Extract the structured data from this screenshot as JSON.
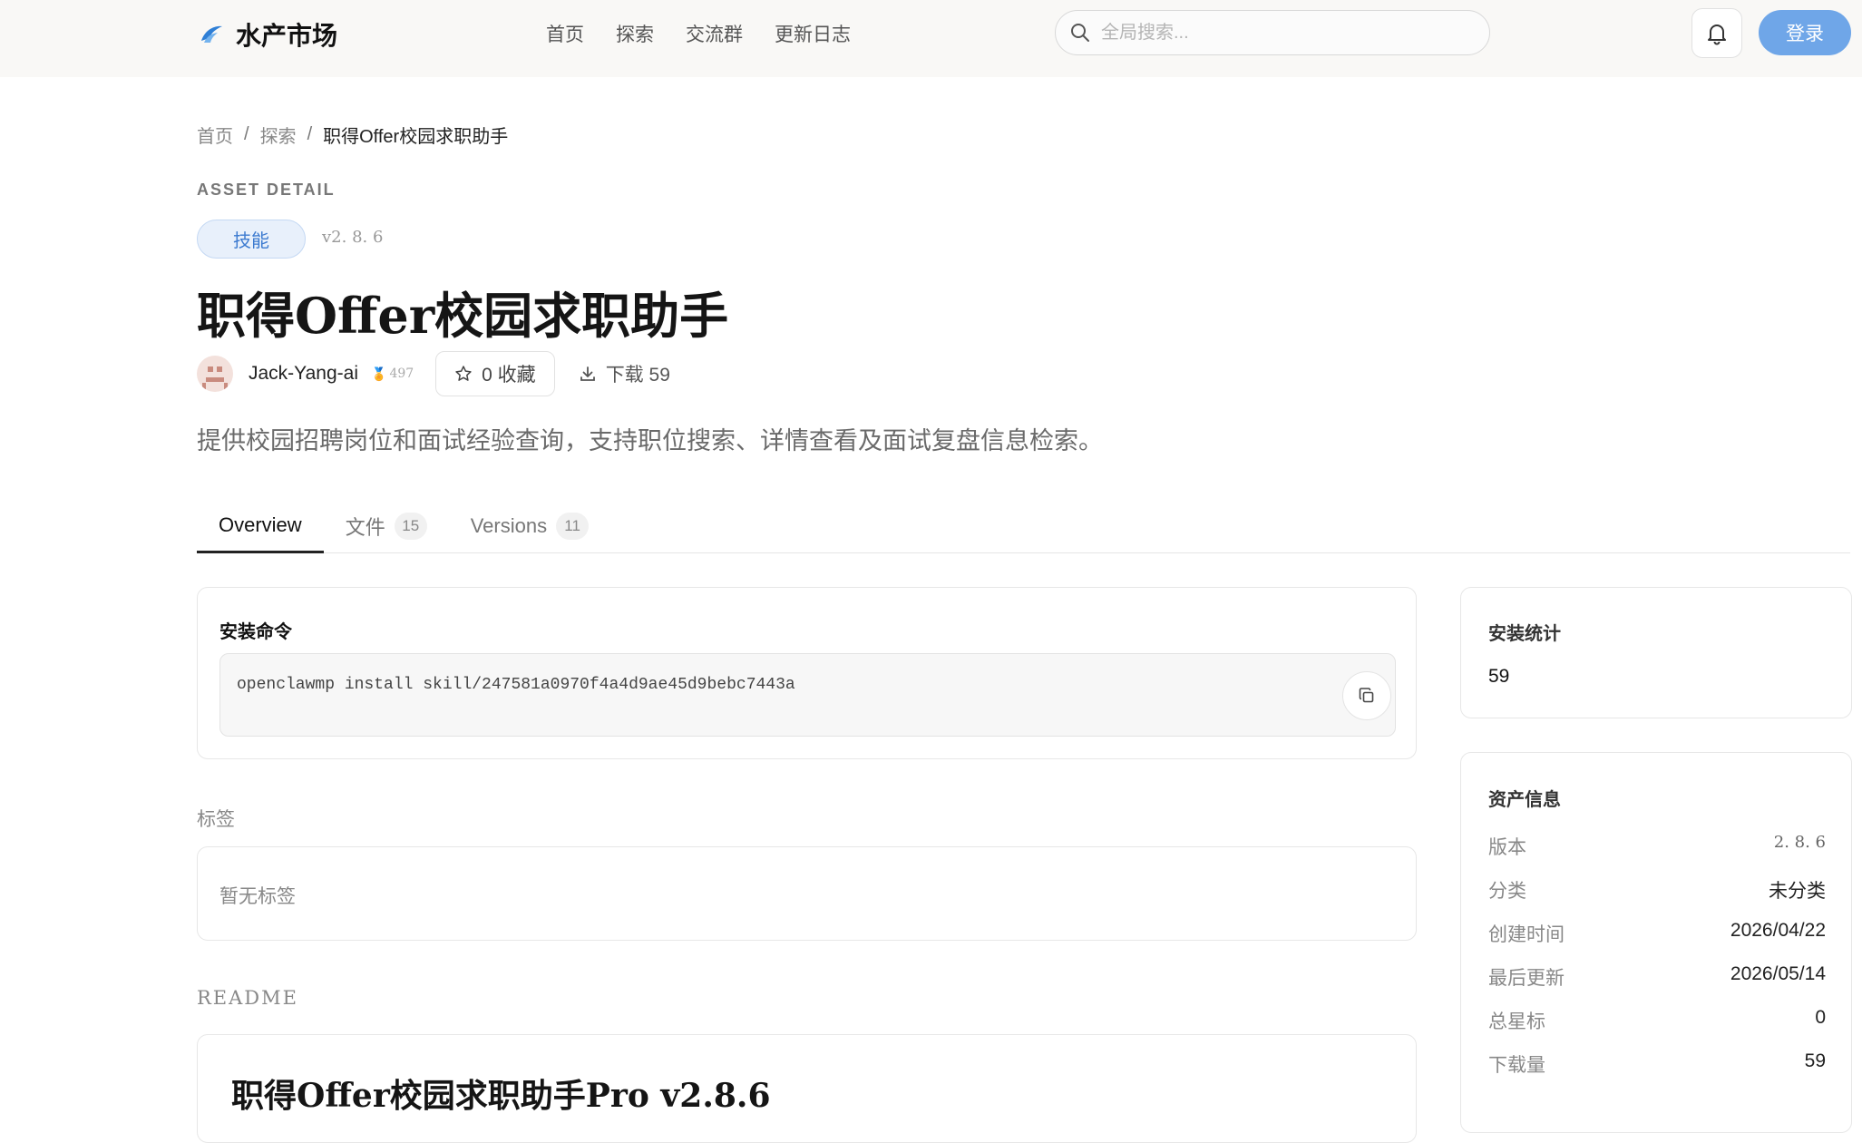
{
  "header": {
    "brand_name": "水产市场",
    "nav": [
      "首页",
      "探索",
      "交流群",
      "更新日志"
    ],
    "search_placeholder": "全局搜索...",
    "login_label": "登录"
  },
  "breadcrumb": [
    "首页",
    "探索",
    "职得Offer校园求职助手"
  ],
  "asset": {
    "eyebrow": "ASSET DETAIL",
    "type_badge": "技能",
    "version": "v2. 8. 6",
    "title": "职得Offer校园求职助手",
    "author": "Jack-Yang-ai",
    "reputation": "497",
    "favorites_label": "0 收藏",
    "downloads_label": "下载 59",
    "description": "提供校园招聘岗位和面试经验查询，支持职位搜索、详情查看及面试复盘信息检索。"
  },
  "tabs": [
    {
      "label": "Overview",
      "count": ""
    },
    {
      "label": "文件",
      "count": "15"
    },
    {
      "label": "Versions",
      "count": "11"
    }
  ],
  "install": {
    "title": "安装命令",
    "command": "openclawmp install skill/247581a0970f4a4d9ae45d9bebc7443a"
  },
  "tags": {
    "label": "标签",
    "empty": "暂无标签"
  },
  "readme": {
    "label": "README",
    "heading": "职得Offer校园求职助手Pro v2.8.6"
  },
  "stats": {
    "title": "安装统计",
    "value": "59"
  },
  "info": {
    "title": "资产信息",
    "rows": [
      {
        "key": "版本",
        "value": "2. 8. 6"
      },
      {
        "key": "分类",
        "value": "未分类"
      },
      {
        "key": "创建时间",
        "value": "2026/04/22"
      },
      {
        "key": "最后更新",
        "value": "2026/05/14"
      },
      {
        "key": "总星标",
        "value": "0"
      },
      {
        "key": "下载量",
        "value": "59"
      }
    ]
  },
  "colors": {
    "accent": "#6fa6e8",
    "badge_bg": "#e8f0fb",
    "badge_text": "#3d7bd0"
  },
  "icons": [
    "brand-logo-icon",
    "search-icon",
    "bell-icon",
    "medal-icon",
    "star-icon",
    "download-icon",
    "copy-icon"
  ]
}
